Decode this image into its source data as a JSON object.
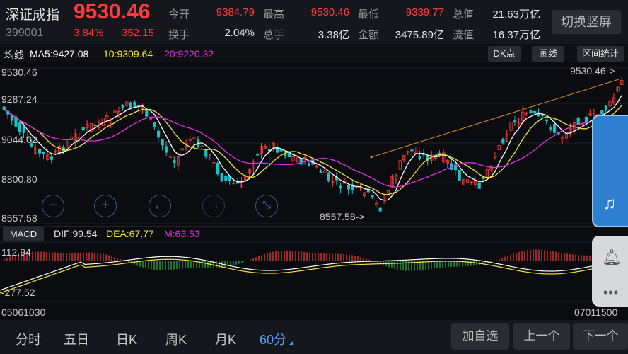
{
  "header": {
    "name": "深证成指",
    "price": "9530.46",
    "code": "399001",
    "pct": "3.84%",
    "change": "352.15",
    "stats": [
      {
        "label": "今开",
        "value": "9384.79",
        "color": "red"
      },
      {
        "label": "最高",
        "value": "9530.46",
        "color": "red"
      },
      {
        "label": "最低",
        "value": "9339.77",
        "color": "red"
      },
      {
        "label": "总值",
        "value": "21.63万亿",
        "color": "wht"
      },
      {
        "label": "换手",
        "value": "2.04%",
        "color": "wht"
      },
      {
        "label": "总手",
        "value": "3.38亿",
        "color": "wht"
      },
      {
        "label": "金额",
        "value": "3475.89亿",
        "color": "wht"
      },
      {
        "label": "流值",
        "value": "16.37万亿",
        "color": "wht"
      }
    ],
    "switch_label": "切换竖屏"
  },
  "legend": {
    "mode": "均线",
    "ma5": "MA5:9427.08",
    "ma10": "10:9309.64",
    "ma20": "20:9220.32",
    "btn_dk": "DK点",
    "btn_draw": "画线",
    "btn_stats": "区间统计"
  },
  "price_axis": {
    "top": "9530.46",
    "mid1": "9287.24",
    "mid2": "9044.02",
    "mid3": "8800.80",
    "bottom": "8557.58",
    "high_marker": "9530.46->",
    "low_marker": "8557.58->"
  },
  "macd": {
    "btn": "MACD",
    "dif": "DIF:99.54",
    "dea": "DEA:67.77",
    "m": "M:63.53",
    "top": "112.94",
    "bottom": "-277.52"
  },
  "time_axis": {
    "start": "05061030",
    "end": "07011500"
  },
  "tabs": [
    {
      "label": "分时"
    },
    {
      "label": "五日"
    },
    {
      "label": "日K"
    },
    {
      "label": "周K"
    },
    {
      "label": "月K"
    },
    {
      "label": "60分"
    }
  ],
  "buttons": {
    "add": "加自选",
    "prev": "上一个",
    "next": "下一个"
  },
  "colors": {
    "up": "#ff3b3b",
    "down": "#19c3c3",
    "ma5": "#ffffff",
    "ma10": "#f5e431",
    "ma20": "#e62ce6",
    "accent": "#4aa3ff"
  }
}
